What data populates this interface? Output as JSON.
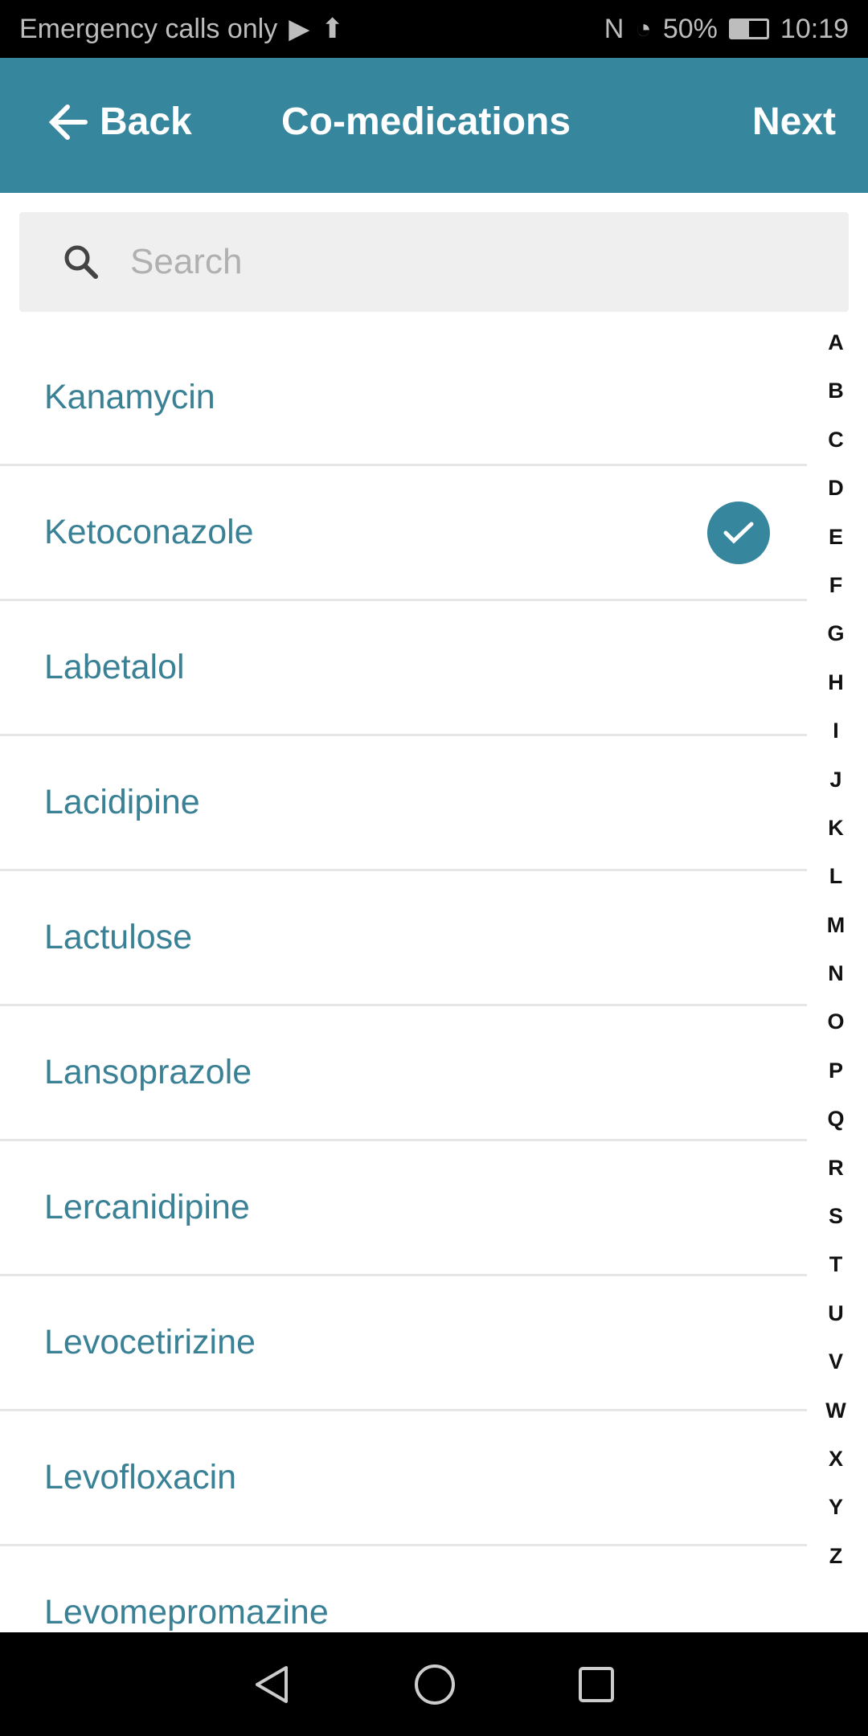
{
  "status_bar": {
    "carrier": "Emergency calls only",
    "battery": "50%",
    "time": "10:19"
  },
  "header": {
    "back_label": "Back",
    "title": "Co-medications",
    "next_label": "Next"
  },
  "search": {
    "placeholder": "Search",
    "value": ""
  },
  "medications": [
    {
      "name": "Kanamycin",
      "selected": false
    },
    {
      "name": "Ketoconazole",
      "selected": true
    },
    {
      "name": "Labetalol",
      "selected": false
    },
    {
      "name": "Lacidipine",
      "selected": false
    },
    {
      "name": "Lactulose",
      "selected": false
    },
    {
      "name": "Lansoprazole",
      "selected": false
    },
    {
      "name": "Lercanidipine",
      "selected": false
    },
    {
      "name": "Levocetirizine",
      "selected": false
    },
    {
      "name": "Levofloxacin",
      "selected": false
    },
    {
      "name": "Levomepromazine",
      "selected": false
    }
  ],
  "index_letters": [
    "A",
    "B",
    "C",
    "D",
    "E",
    "F",
    "G",
    "H",
    "I",
    "J",
    "K",
    "L",
    "M",
    "N",
    "O",
    "P",
    "Q",
    "R",
    "S",
    "T",
    "U",
    "V",
    "W",
    "X",
    "Y",
    "Z"
  ],
  "colors": {
    "accent": "#36869e",
    "item_text": "#3a8196"
  }
}
